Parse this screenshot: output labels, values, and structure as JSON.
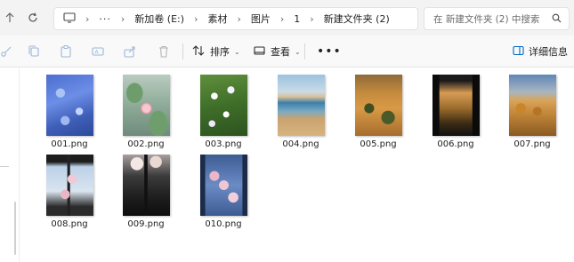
{
  "address_bar": {
    "crumbs": [
      "新加卷 (E:)",
      "素材",
      "图片",
      "1",
      "新建文件夹 (2)"
    ],
    "search_placeholder": "在 新建文件夹 (2) 中搜索"
  },
  "toolbar": {
    "sort_label": "排序",
    "view_label": "查看",
    "more_label": "•••",
    "details_label": "详细信息"
  },
  "files": [
    {
      "name": "001.png",
      "icon": "image-thumbnail"
    },
    {
      "name": "002.png",
      "icon": "image-thumbnail"
    },
    {
      "name": "003.png",
      "icon": "image-thumbnail"
    },
    {
      "name": "004.png",
      "icon": "image-thumbnail"
    },
    {
      "name": "005.png",
      "icon": "image-thumbnail"
    },
    {
      "name": "006.png",
      "icon": "image-thumbnail"
    },
    {
      "name": "007.png",
      "icon": "image-thumbnail"
    },
    {
      "name": "008.png",
      "icon": "image-thumbnail"
    },
    {
      "name": "009.png",
      "icon": "image-thumbnail"
    },
    {
      "name": "010.png",
      "icon": "image-thumbnail"
    }
  ],
  "colors": {
    "accent": "#0067c0",
    "chrome_bg": "#f3f3f3",
    "toolbar_bg": "#f9f9f9"
  }
}
